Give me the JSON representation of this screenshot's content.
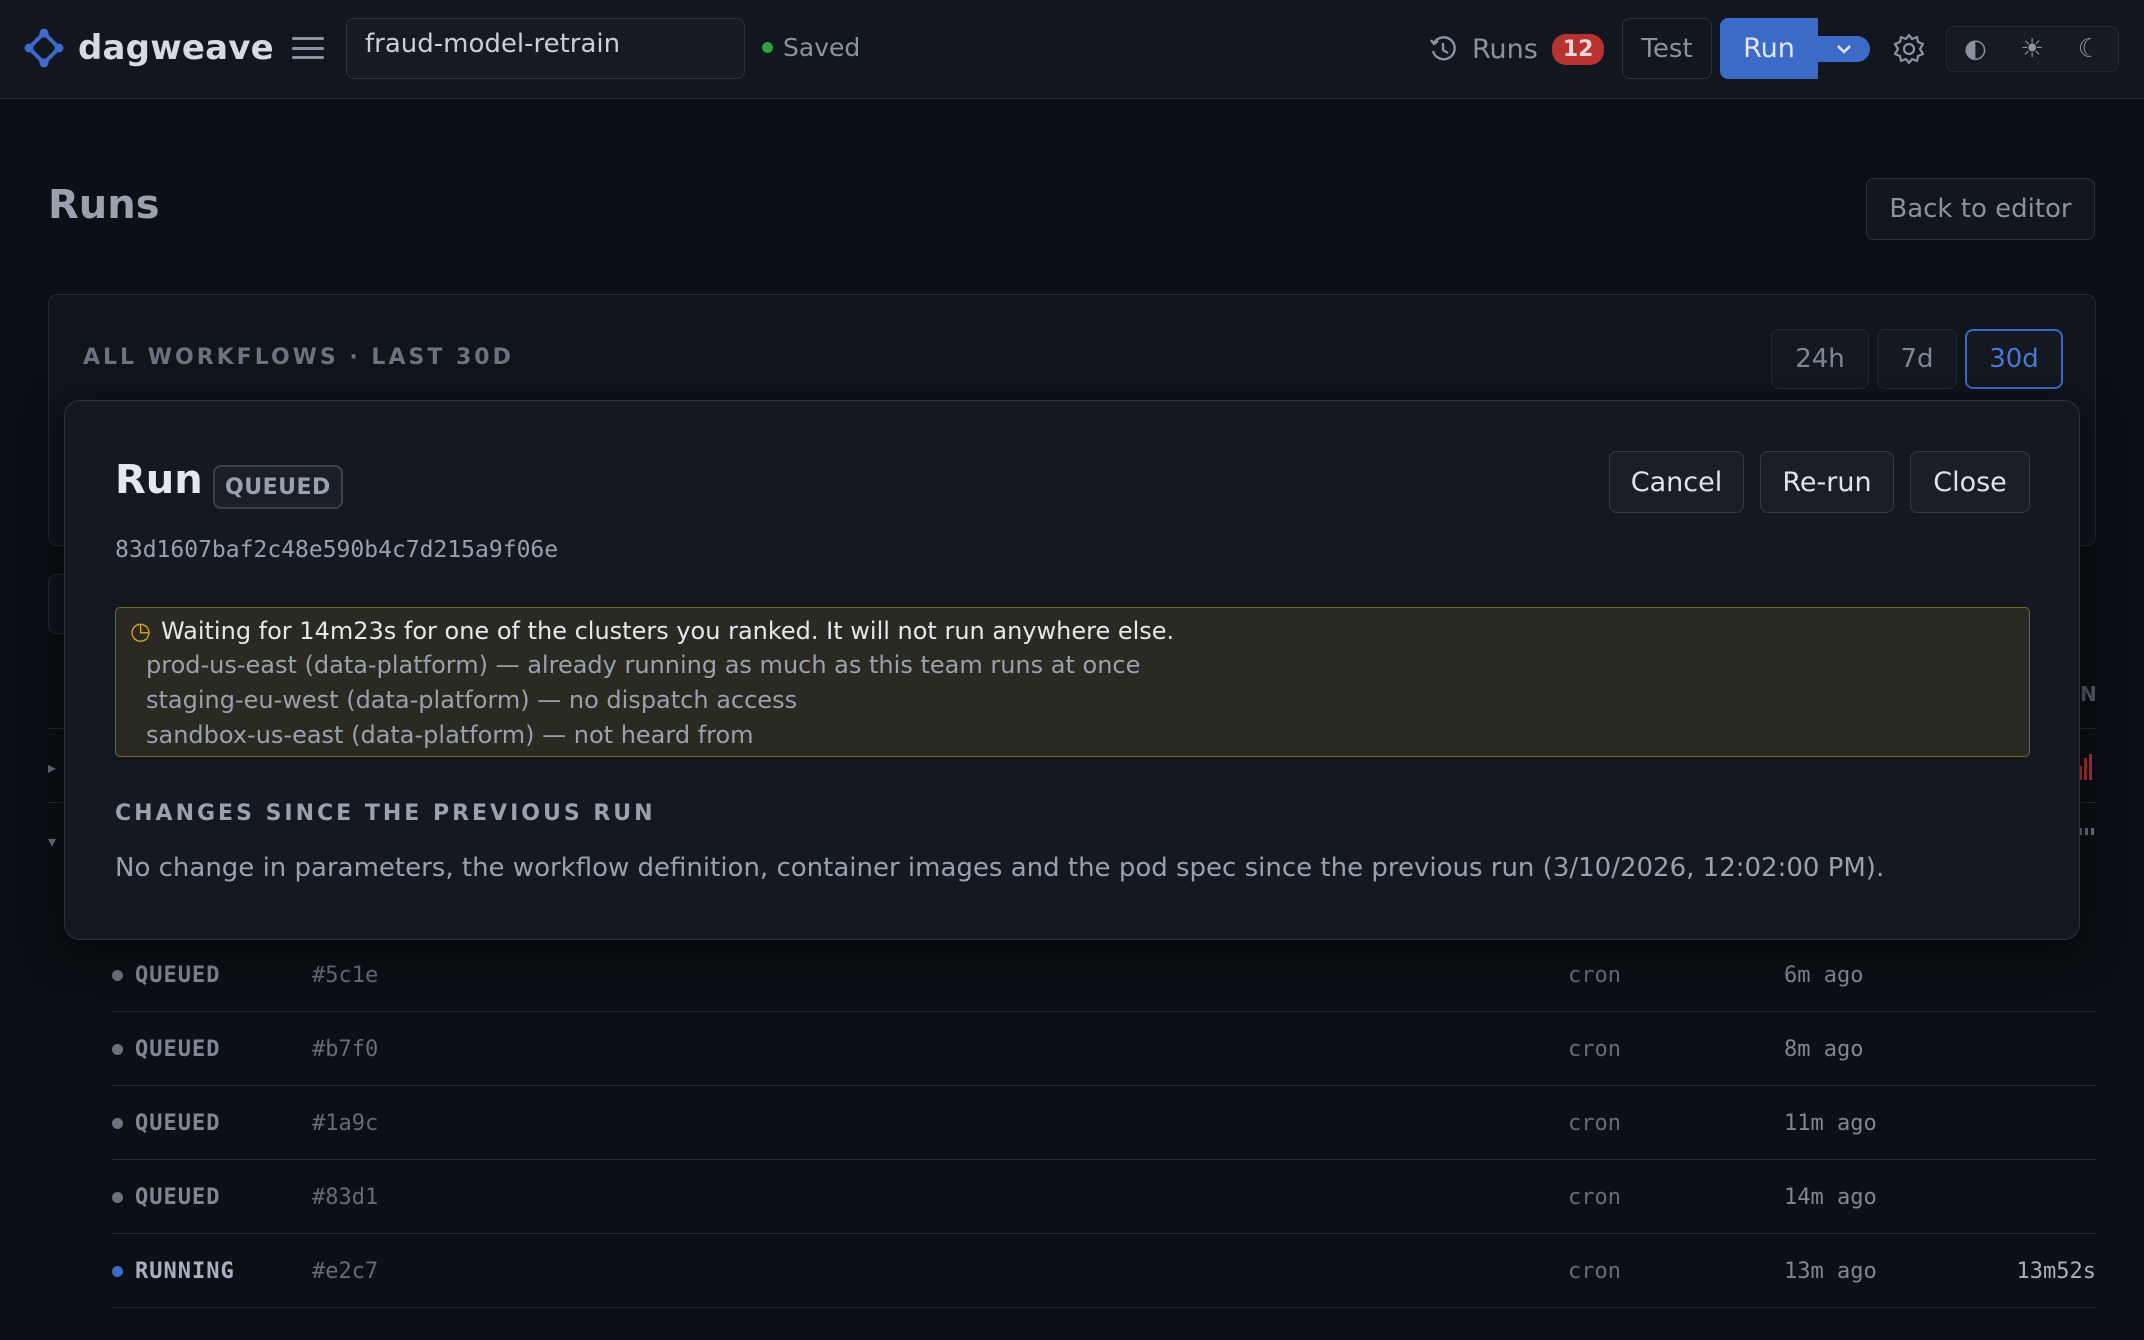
{
  "app": {
    "name": "dagweave"
  },
  "header": {
    "workflow_name": "fraud-model-retrain",
    "saved_label": "Saved",
    "runs_label": "Runs",
    "runs_count": "12",
    "test_label": "Test",
    "run_label": "Run",
    "theme_options": [
      "◐",
      "☀",
      "☾"
    ]
  },
  "page": {
    "title": "Runs",
    "back_label": "Back to editor"
  },
  "stats": {
    "label": "ALL WORKFLOWS · LAST 30D",
    "ranges": [
      "24h",
      "7d",
      "30d"
    ],
    "active_range": "30d"
  },
  "table": {
    "header_stub": "N",
    "rows": [
      {
        "status": "QUEUED",
        "id": "#5c1e",
        "trigger": "cron",
        "ago": "6m ago",
        "duration": ""
      },
      {
        "status": "QUEUED",
        "id": "#b7f0",
        "trigger": "cron",
        "ago": "8m ago",
        "duration": ""
      },
      {
        "status": "QUEUED",
        "id": "#1a9c",
        "trigger": "cron",
        "ago": "11m ago",
        "duration": ""
      },
      {
        "status": "QUEUED",
        "id": "#83d1",
        "trigger": "cron",
        "ago": "14m ago",
        "duration": ""
      },
      {
        "status": "RUNNING",
        "id": "#e2c7",
        "trigger": "cron",
        "ago": "13m ago",
        "duration": "13m52s"
      }
    ]
  },
  "modal": {
    "title": "Run",
    "status": "QUEUED",
    "cancel_label": "Cancel",
    "rerun_label": "Re-run",
    "close_label": "Close",
    "run_id": "83d1607baf2c48e590b4c7d215a9f06e",
    "wait": {
      "icon": "◷",
      "headline": "Waiting for 14m23s for one of the clusters you ranked. It will not run anywhere else.",
      "clusters": [
        "prod-us-east (data-platform) — already running as much as this team runs at once",
        "staging-eu-west (data-platform) — no dispatch access",
        "sandbox-us-east (data-platform) — not heard from"
      ]
    },
    "changes_heading": "CHANGES SINCE THE PREVIOUS RUN",
    "changes_text": "No change in parameters, the workflow definition, container images and the pod spec since the previous run (3/10/2026, 12:02:00 PM)."
  },
  "colors": {
    "accent": "#3b6ac7",
    "danger": "#b83232",
    "success": "#2ea043",
    "warning": "#d4a72c"
  }
}
